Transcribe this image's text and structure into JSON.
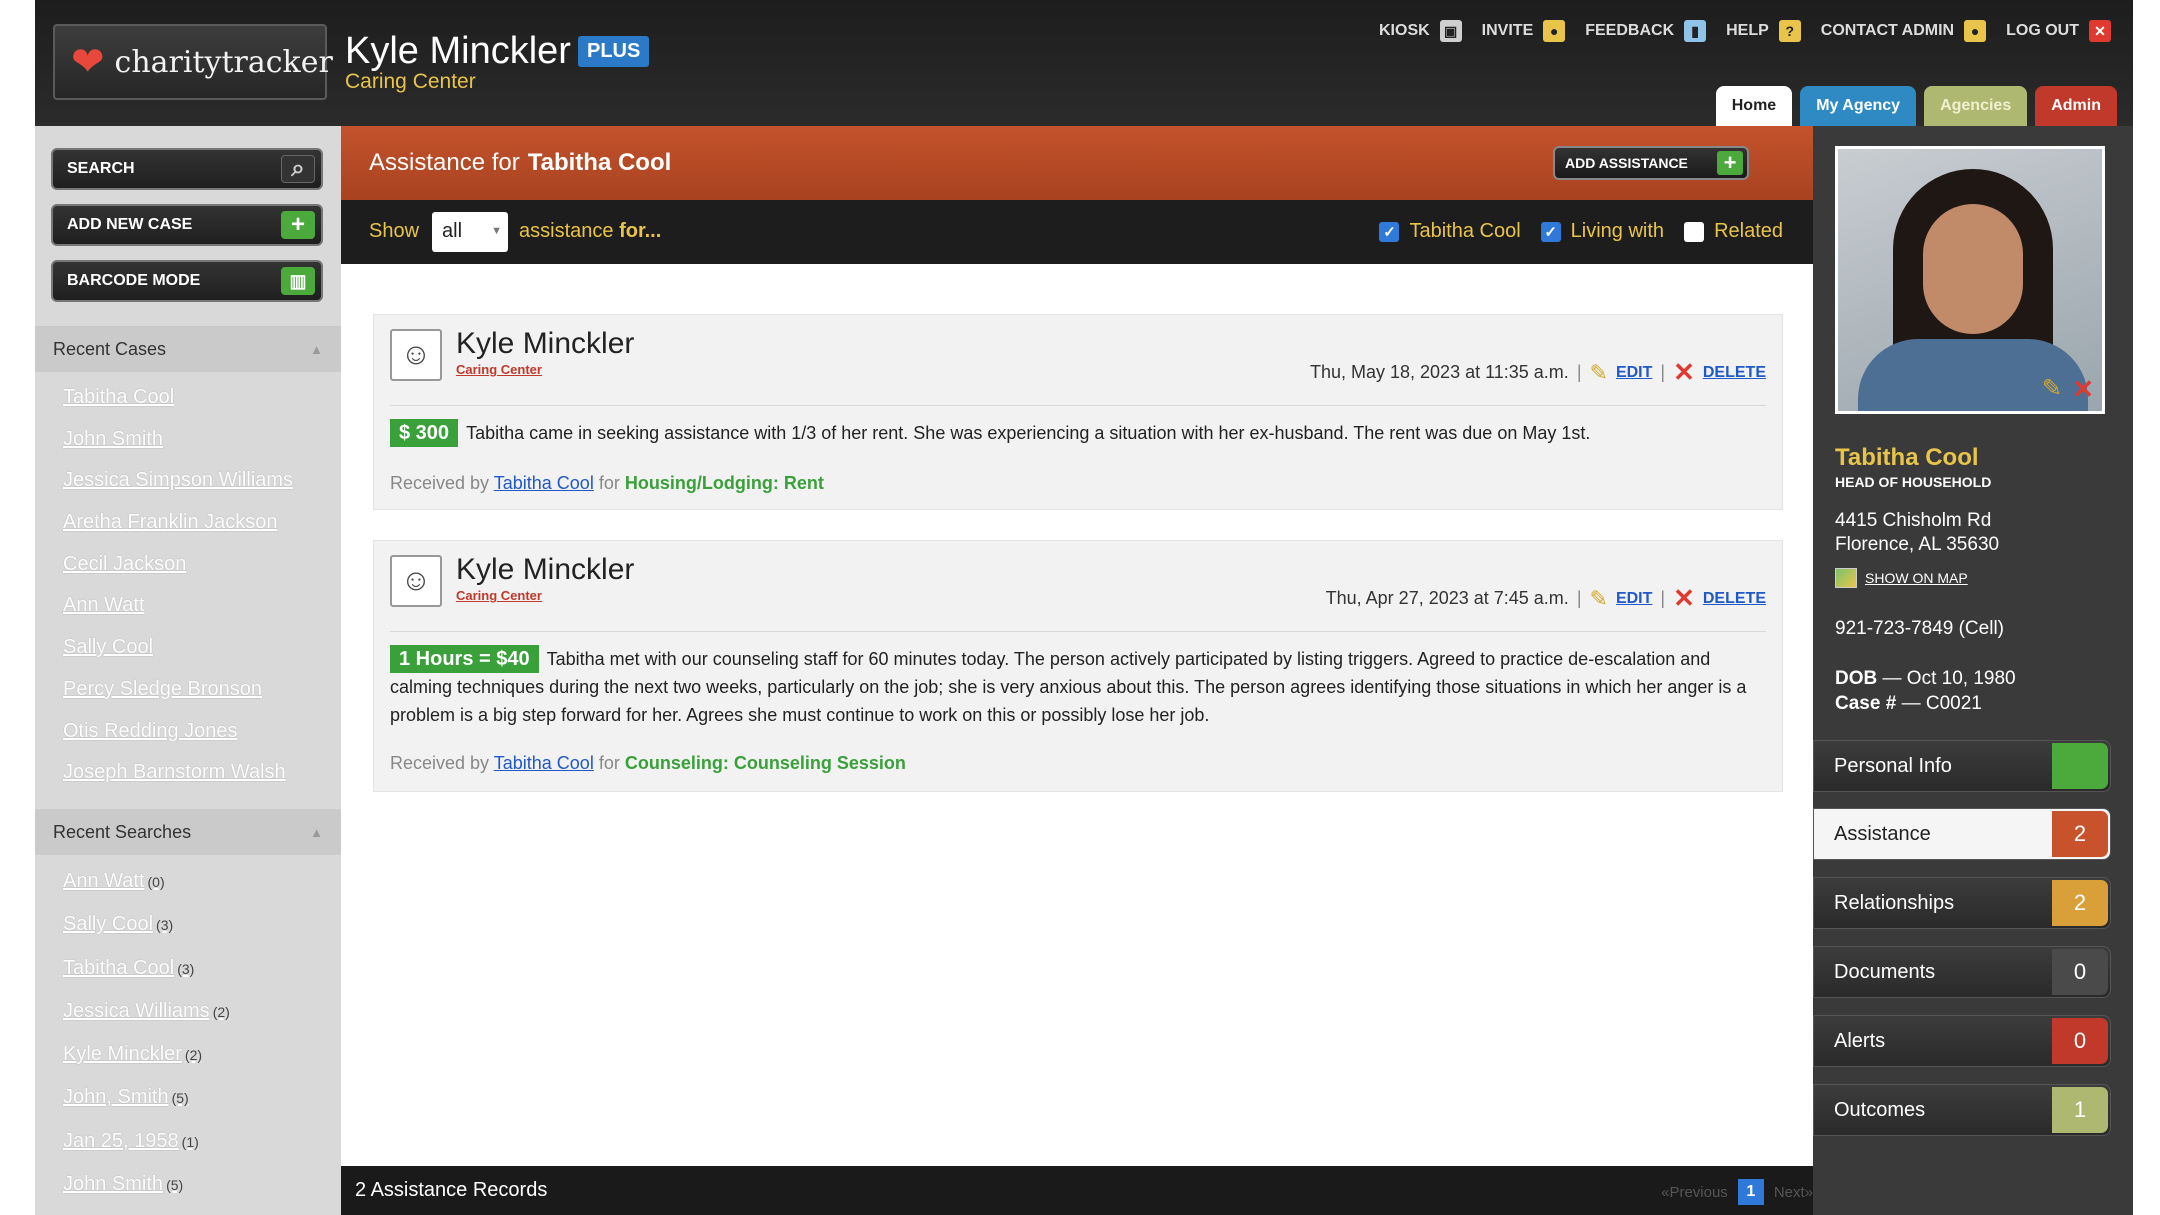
{
  "brand": {
    "logo_text": "charitytracker"
  },
  "header": {
    "user_name": "Kyle Minckler",
    "plan_badge": "PLUS",
    "center_name": "Caring Center",
    "top_links": [
      {
        "label": "KIOSK",
        "icon": "kiosk-icon"
      },
      {
        "label": "INVITE",
        "icon": "person-icon"
      },
      {
        "label": "FEEDBACK",
        "icon": "feedback-icon"
      },
      {
        "label": "HELP",
        "icon": "help-icon"
      },
      {
        "label": "CONTACT ADMIN",
        "icon": "person-icon"
      },
      {
        "label": "LOG OUT",
        "icon": "close-icon"
      }
    ],
    "tabs": [
      {
        "label": "Home",
        "active": true
      },
      {
        "label": "My Agency"
      },
      {
        "label": "Agencies"
      },
      {
        "label": "Admin"
      }
    ]
  },
  "sidebar": {
    "buttons": {
      "search": "SEARCH",
      "add_case": "ADD NEW CASE",
      "barcode": "BARCODE MODE"
    },
    "recent_cases_title": "Recent Cases",
    "recent_cases": [
      "Tabitha Cool",
      "John Smith",
      "Jessica Simpson Williams",
      "Aretha Franklin Jackson",
      "Cecil Jackson",
      "Ann Watt",
      "Sally Cool",
      "Percy Sledge Bronson",
      "Otis Redding Jones",
      "Joseph Barnstorm Walsh"
    ],
    "recent_searches_title": "Recent Searches",
    "recent_searches": [
      {
        "term": "Ann Watt",
        "count": "(0)"
      },
      {
        "term": "Sally Cool",
        "count": "(3)"
      },
      {
        "term": "Tabitha Cool",
        "count": "(3)"
      },
      {
        "term": "Jessica Williams",
        "count": "(2)"
      },
      {
        "term": "Kyle Minckler",
        "count": "(2)"
      },
      {
        "term": "John, Smith",
        "count": "(5)"
      },
      {
        "term": "Jan 25, 1958",
        "count": "(1)"
      },
      {
        "term": "John Smith",
        "count": "(5)"
      }
    ]
  },
  "main": {
    "title_prefix": "Assistance for",
    "title_name": "Tabitha Cool",
    "add_button": "ADD ASSISTANCE",
    "filter": {
      "show_label": "Show",
      "show_value": "all",
      "for_text": "assistance",
      "for_bold": "for...",
      "checks": [
        {
          "label": "Tabitha Cool",
          "checked": true
        },
        {
          "label": "Living with",
          "checked": true
        },
        {
          "label": "Related",
          "checked": false
        }
      ]
    },
    "records": [
      {
        "author": "Kyle Minckler",
        "center": "Caring Center",
        "date": "Thu, May 18, 2023 at 11:35 a.m.",
        "edit": "EDIT",
        "delete": "DELETE",
        "amount": "$ 300",
        "text": "Tabitha came in seeking assistance with 1/3 of her rent. She was experiencing a situation with her ex-husband. The rent was due on May 1st.",
        "received_prefix": "Received by",
        "received_name": "Tabitha Cool",
        "received_for": "for",
        "category": "Housing/Lodging: Rent"
      },
      {
        "author": "Kyle Minckler",
        "center": "Caring Center",
        "date": "Thu, Apr 27, 2023 at 7:45 a.m.",
        "edit": "EDIT",
        "delete": "DELETE",
        "amount": "1 Hours = $40",
        "text": "Tabitha met with our counseling staff for 60 minutes today. The person actively participated by listing triggers. Agreed to practice de-escalation and calming techniques during the next two weeks, particularly on the job; she is very anxious about this. The person agrees identifying those situations in which her anger is a problem is a big step forward for her. Agrees she must continue to work on this or possibly lose her job.",
        "received_prefix": "Received by",
        "received_name": "Tabitha Cool",
        "received_for": "for",
        "category": "Counseling: Counseling Session"
      }
    ],
    "footer_count": "2 Assistance Records",
    "pager": {
      "prev": "«Previous",
      "page": "1",
      "next": "Next»"
    }
  },
  "client": {
    "name": "Tabitha Cool",
    "role": "HEAD OF HOUSEHOLD",
    "address1": "4415 Chisholm Rd",
    "address2": "Florence, AL  35630",
    "map_link": "SHOW ON MAP",
    "phone": "921-723-7849 (Cell)",
    "dob_label": "DOB",
    "dob": "— Oct 10, 1980",
    "case_label": "Case #",
    "case": "— C0021",
    "nav": [
      {
        "label": "Personal Info",
        "count": "",
        "color": "#4caa3c"
      },
      {
        "label": "Assistance",
        "count": "2",
        "color": "#c8522c"
      },
      {
        "label": "Relationships",
        "count": "2",
        "color": "#d9a03a"
      },
      {
        "label": "Documents",
        "count": "0",
        "color": "#4a4a4a"
      },
      {
        "label": "Alerts",
        "count": "0",
        "color": "#c0392b"
      },
      {
        "label": "Outcomes",
        "count": "1",
        "color": "#aeb870"
      }
    ]
  },
  "colors": {
    "accent_orange": "#b84a26",
    "accent_yellow": "#e9c44a",
    "link_blue": "#1f58c8",
    "green": "#3aa03a"
  }
}
